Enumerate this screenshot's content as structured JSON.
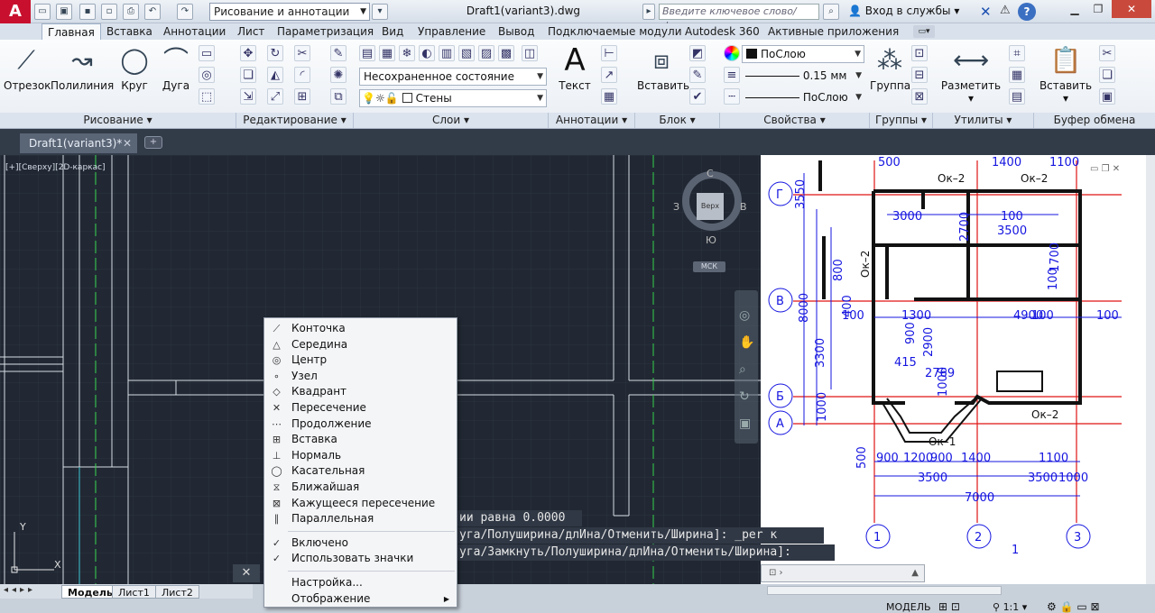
{
  "app": {
    "logo": "A",
    "title": "Draft1(variant3).dwg",
    "workspace": "Рисование и аннотации",
    "search_placeholder": "Введите ключевое слово/фразу",
    "signin": "Вход в службы",
    "help": "?"
  },
  "ribbon_tabs": [
    "Главная",
    "Вставка",
    "Аннотации",
    "Лист",
    "Параметризация",
    "Вид",
    "Управление",
    "Вывод",
    "Подключаемые модули",
    "Autodesk 360",
    "Активные приложения"
  ],
  "draw": {
    "line": "Отрезок",
    "polyline": "Полилиния",
    "circle": "Круг",
    "arc": "Дуга",
    "footer": "Рисование"
  },
  "modify": {
    "footer": "Редактирование"
  },
  "layers": {
    "state": "Несохраненное состояние листа",
    "current": "Стены",
    "footer": "Слои"
  },
  "annotation": {
    "text": "Текст",
    "footer": "Аннотации"
  },
  "block": {
    "insert": "Вставить",
    "footer": "Блок"
  },
  "properties": {
    "color": "ПоСлою",
    "lineweight": "0.15 мм",
    "linetype": "ПоСлою",
    "footer": "Свойства"
  },
  "groups": {
    "group": "Группа",
    "footer": "Группы"
  },
  "utilities": {
    "measure": "Разметить",
    "footer": "Утилиты"
  },
  "clipboard": {
    "paste": "Вставить",
    "footer": "Буфер обмена"
  },
  "filetab": {
    "label": "Draft1(variant3)*",
    "close": "✕"
  },
  "viewport": {
    "label": "[+][Сверху][2D-каркас]",
    "cube": {
      "n": "С",
      "s": "Ю",
      "w": "З",
      "e": "В",
      "face": "Верх"
    },
    "ucs": "МСК",
    "axis_y": "Y",
    "axis_x": "X"
  },
  "context_menu": {
    "items": [
      {
        "label": "Конточка",
        "icon": "endpoint-icon"
      },
      {
        "label": "Середина",
        "icon": "midpoint-icon"
      },
      {
        "label": "Центр",
        "icon": "center-icon"
      },
      {
        "label": "Узел",
        "icon": "node-icon"
      },
      {
        "label": "Квадрант",
        "icon": "quadrant-icon"
      },
      {
        "label": "Пересечение",
        "icon": "intersection-icon"
      },
      {
        "label": "Продолжение",
        "icon": "extension-icon"
      },
      {
        "label": "Вставка",
        "icon": "insertion-icon"
      },
      {
        "label": "Нормаль",
        "icon": "perpendicular-icon"
      },
      {
        "label": "Касательная",
        "icon": "tangent-icon"
      },
      {
        "label": "Ближайшая",
        "icon": "nearest-icon"
      },
      {
        "label": "Кажущееся пересечение",
        "icon": "apparent-intersection-icon"
      },
      {
        "label": "Параллельная",
        "icon": "parallel-icon"
      }
    ],
    "enabled": "Включено",
    "use_icons": "Использовать значки",
    "settings": "Настройка...",
    "display": "Отображение"
  },
  "command": {
    "line1": "ии равна 0.0000",
    "line2": "уга/Полуширина/длИна/Отменить/Ширина]:  _per к",
    "line3": "уга/Замкнуть/Полуширина/длИна/Отменить/Ширина]:"
  },
  "layout_tabs": [
    "Модель",
    "Лист1",
    "Лист2"
  ],
  "status": {
    "model": "МОДЕЛЬ",
    "scale": "1:1"
  },
  "plan": {
    "axes": [
      "Г",
      "В",
      "Б",
      "А",
      "1",
      "2",
      "3"
    ],
    "dims": [
      "500",
      "1400",
      "1100",
      "3550",
      "3000",
      "100",
      "3500",
      "2700",
      "1300",
      "900",
      "800",
      "400",
      "100",
      "100",
      "4900",
      "100",
      "1000",
      "3300",
      "100",
      "2900",
      "1700",
      "415",
      "2769",
      "1000",
      "500",
      "900",
      "1200",
      "900",
      "1400",
      "1100",
      "3500",
      "3500",
      "1000",
      "7000",
      "8000",
      "1"
    ],
    "labels": [
      "Ок–2",
      "Ок–2",
      "Ок–2",
      "Ок–2",
      "Ок–1"
    ]
  },
  "colors": {
    "accent": "#c8102e",
    "viewport": "#212833",
    "plan_blue": "#1515e0",
    "plan_red": "#e01515"
  }
}
